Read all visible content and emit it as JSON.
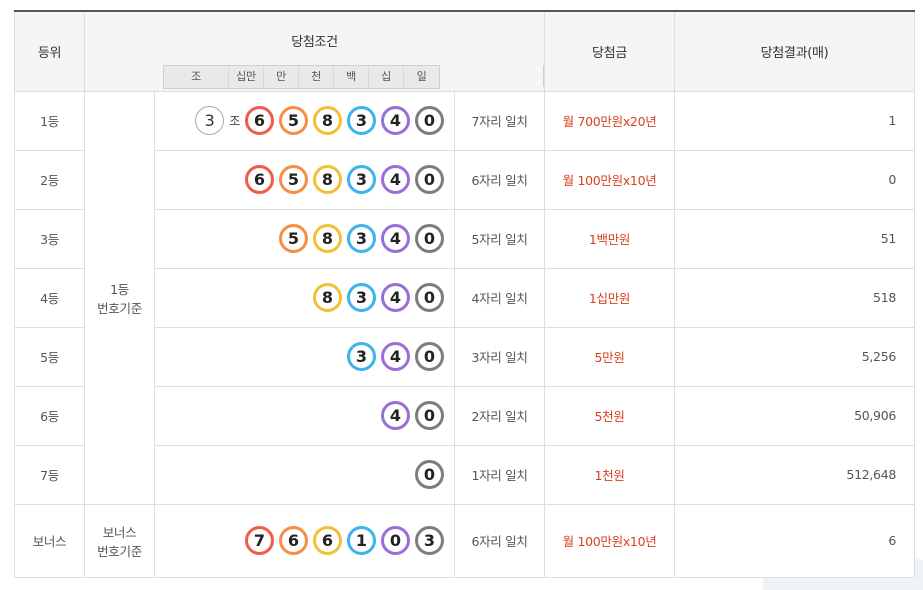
{
  "header": {
    "rank": "등위",
    "condition": "당첨조건",
    "prize": "당첨금",
    "result": "당첨결과(매)",
    "digits": [
      "조",
      "십만",
      "만",
      "천",
      "백",
      "십",
      "일"
    ]
  },
  "group": {
    "first": [
      "1등",
      "번호기준"
    ],
    "bonus": [
      "보너스",
      "번호기준"
    ]
  },
  "colors": {
    "red": "#f05c4a",
    "orange": "#f58f45",
    "yellow": "#f4c033",
    "sky": "#3db4ec",
    "purple": "#9b6dd6",
    "gray": "#7d7d7d",
    "prize_text": "#d6411f"
  },
  "rows": [
    {
      "rank": "1등",
      "jo": "3",
      "jo_label": "조",
      "balls": [
        {
          "n": "6",
          "c": "red"
        },
        {
          "n": "5",
          "c": "orange"
        },
        {
          "n": "8",
          "c": "yellow"
        },
        {
          "n": "3",
          "c": "sky"
        },
        {
          "n": "4",
          "c": "purple"
        },
        {
          "n": "0",
          "c": "gray"
        }
      ],
      "match": "7자리 일치",
      "prize": "월 700만원x20년",
      "count": "1"
    },
    {
      "rank": "2등",
      "balls": [
        {
          "n": "6",
          "c": "red"
        },
        {
          "n": "5",
          "c": "orange"
        },
        {
          "n": "8",
          "c": "yellow"
        },
        {
          "n": "3",
          "c": "sky"
        },
        {
          "n": "4",
          "c": "purple"
        },
        {
          "n": "0",
          "c": "gray"
        }
      ],
      "match": "6자리 일치",
      "prize": "월 100만원x10년",
      "count": "0"
    },
    {
      "rank": "3등",
      "balls": [
        {
          "n": "5",
          "c": "orange"
        },
        {
          "n": "8",
          "c": "yellow"
        },
        {
          "n": "3",
          "c": "sky"
        },
        {
          "n": "4",
          "c": "purple"
        },
        {
          "n": "0",
          "c": "gray"
        }
      ],
      "match": "5자리 일치",
      "prize": "1백만원",
      "count": "51"
    },
    {
      "rank": "4등",
      "balls": [
        {
          "n": "8",
          "c": "yellow"
        },
        {
          "n": "3",
          "c": "sky"
        },
        {
          "n": "4",
          "c": "purple"
        },
        {
          "n": "0",
          "c": "gray"
        }
      ],
      "match": "4자리 일치",
      "prize": "1십만원",
      "count": "518"
    },
    {
      "rank": "5등",
      "balls": [
        {
          "n": "3",
          "c": "sky"
        },
        {
          "n": "4",
          "c": "purple"
        },
        {
          "n": "0",
          "c": "gray"
        }
      ],
      "match": "3자리 일치",
      "prize": "5만원",
      "count": "5,256"
    },
    {
      "rank": "6등",
      "balls": [
        {
          "n": "4",
          "c": "purple"
        },
        {
          "n": "0",
          "c": "gray"
        }
      ],
      "match": "2자리 일치",
      "prize": "5천원",
      "count": "50,906"
    },
    {
      "rank": "7등",
      "balls": [
        {
          "n": "0",
          "c": "gray"
        }
      ],
      "match": "1자리 일치",
      "prize": "1천원",
      "count": "512,648"
    },
    {
      "rank": "보너스",
      "balls": [
        {
          "n": "7",
          "c": "red"
        },
        {
          "n": "6",
          "c": "orange"
        },
        {
          "n": "6",
          "c": "yellow"
        },
        {
          "n": "1",
          "c": "sky"
        },
        {
          "n": "0",
          "c": "purple"
        },
        {
          "n": "3",
          "c": "gray"
        }
      ],
      "match": "6자리 일치",
      "prize": "월 100만원x10년",
      "count": "6"
    }
  ]
}
